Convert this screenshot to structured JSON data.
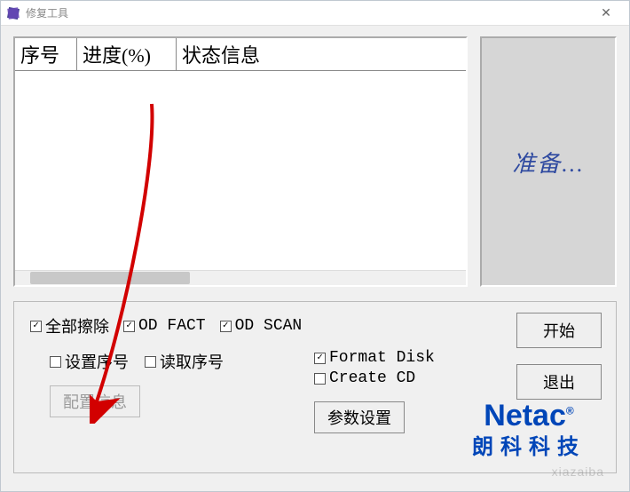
{
  "window": {
    "title": "修复工具"
  },
  "grid": {
    "columns": [
      "序号",
      "进度(%)",
      "状态信息"
    ]
  },
  "status": {
    "text": "准备..."
  },
  "checks": {
    "wipe_all": {
      "label": "全部擦除",
      "checked": true
    },
    "od_fact": {
      "label": "OD FACT",
      "checked": true
    },
    "od_scan": {
      "label": "OD SCAN",
      "checked": true
    },
    "set_serial": {
      "label": "设置序号",
      "checked": false
    },
    "read_serial": {
      "label": "读取序号",
      "checked": false
    },
    "format_disk": {
      "label": "Format Disk",
      "checked": true
    },
    "create_cd": {
      "label": "Create CD",
      "checked": false
    }
  },
  "buttons": {
    "config_info": "配置信息",
    "param_settings": "参数设置",
    "start": "开始",
    "exit": "退出"
  },
  "logo": {
    "brand": "Netac",
    "reg": "®",
    "sub": "朗科科技"
  },
  "watermark": "xiazaiba"
}
